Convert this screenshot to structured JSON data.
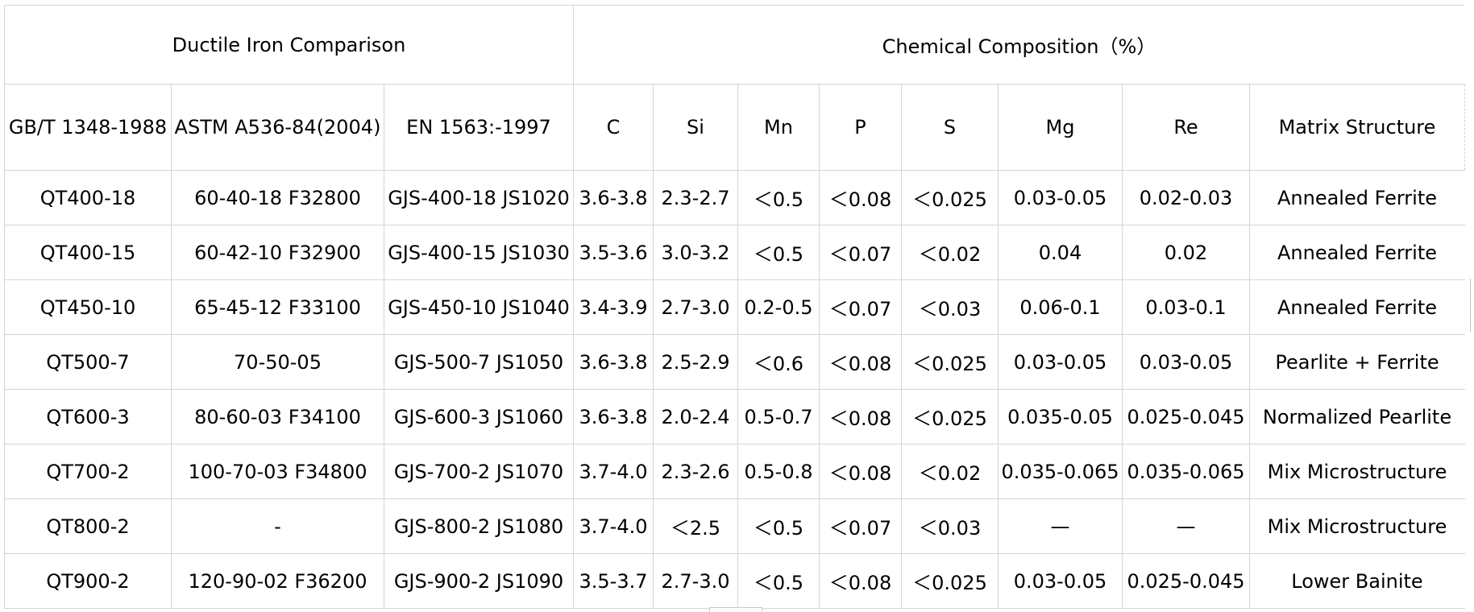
{
  "table": {
    "group_headers": {
      "comparison": "Ductile Iron Comparison",
      "composition": "Chemical Composition（%）"
    },
    "columns": [
      "GB/T 1348-1988",
      "ASTM A536-84(2004)",
      "EN 1563:-1997",
      "C",
      "Si",
      "Mn",
      "P",
      "S",
      "Mg",
      "Re",
      "Matrix Structure"
    ],
    "rows": [
      [
        "QT400-18",
        "60-40-18 F32800",
        "GJS-400-18 JS1020",
        "3.6-3.8",
        "2.3-2.7",
        "＜0.5",
        "＜0.08",
        "＜0.025",
        "0.03-0.05",
        "0.02-0.03",
        "Annealed Ferrite"
      ],
      [
        "QT400-15",
        "60-42-10 F32900",
        "GJS-400-15 JS1030",
        "3.5-3.6",
        "3.0-3.2",
        "＜0.5",
        "＜0.07",
        "＜0.02",
        "0.04",
        "0.02",
        "Annealed Ferrite"
      ],
      [
        "QT450-10",
        "65-45-12 F33100",
        "GJS-450-10 JS1040",
        "3.4-3.9",
        "2.7-3.0",
        "0.2-0.5",
        "＜0.07",
        "＜0.03",
        "0.06-0.1",
        "0.03-0.1",
        "Annealed Ferrite"
      ],
      [
        "QT500-7",
        "70-50-05",
        "GJS-500-7 JS1050",
        "3.6-3.8",
        "2.5-2.9",
        "＜0.6",
        "＜0.08",
        "＜0.025",
        "0.03-0.05",
        "0.03-0.05",
        "Pearlite + Ferrite"
      ],
      [
        "QT600-3",
        "80-60-03 F34100",
        "GJS-600-3 JS1060",
        "3.6-3.8",
        "2.0-2.4",
        "0.5-0.7",
        "＜0.08",
        "＜0.025",
        "0.035-0.05",
        "0.025-0.045",
        "Normalized Pearlite"
      ],
      [
        "QT700-2",
        "100-70-03 F34800",
        "GJS-700-2 JS1070",
        "3.7-4.0",
        "2.3-2.6",
        "0.5-0.8",
        "＜0.08",
        "＜0.02",
        "0.035-0.065",
        "0.035-0.065",
        "Mix Microstructure"
      ],
      [
        "QT800-2",
        "-",
        "GJS-800-2 JS1080",
        "3.7-4.0",
        "＜2.5",
        "＜0.5",
        "＜0.07",
        "＜0.03",
        "—",
        "—",
        "Mix Microstructure"
      ],
      [
        "QT900-2",
        "120-90-02 F36200",
        "GJS-900-2 JS1090",
        "3.5-3.7",
        "2.7-3.0",
        "＜0.5",
        "＜0.08",
        "＜0.025",
        "0.03-0.05",
        "0.025-0.045",
        "Lower Bainite"
      ]
    ]
  }
}
